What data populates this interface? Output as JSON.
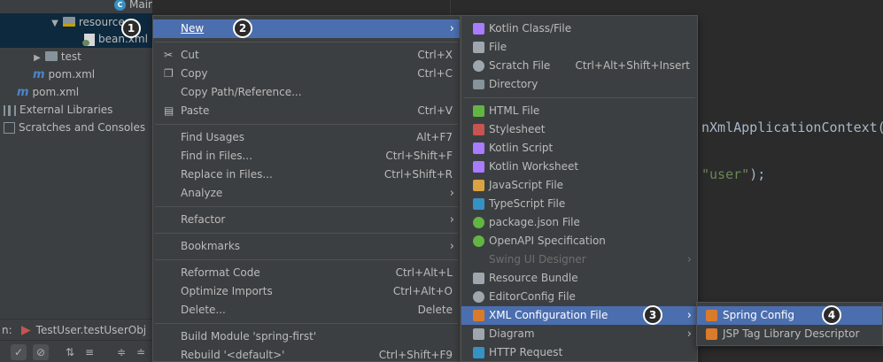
{
  "project_tree": {
    "items": [
      {
        "label": "Main"
      },
      {
        "label": "resources"
      },
      {
        "label": "bean.xml"
      },
      {
        "label": "test"
      },
      {
        "label": "pom.xml"
      },
      {
        "label": "pom.xml"
      },
      {
        "label": "External Libraries"
      },
      {
        "label": "Scratches and Consoles"
      }
    ]
  },
  "run_tab": {
    "prefix": "n:",
    "label": "TestUser.testUserObj"
  },
  "editor": {
    "line1": "nXmlApplicationContext(",
    "line2_str": "\"user\"",
    "line2_rest": ");"
  },
  "context_menu": {
    "items": [
      {
        "label": "New",
        "shortcut": "",
        "submenu": true
      },
      {
        "label": "Cut",
        "shortcut": "Ctrl+X"
      },
      {
        "label": "Copy",
        "shortcut": "Ctrl+C"
      },
      {
        "label": "Copy Path/Reference...",
        "shortcut": ""
      },
      {
        "label": "Paste",
        "shortcut": "Ctrl+V"
      },
      {
        "label": "Find Usages",
        "shortcut": "Alt+F7"
      },
      {
        "label": "Find in Files...",
        "shortcut": "Ctrl+Shift+F"
      },
      {
        "label": "Replace in Files...",
        "shortcut": "Ctrl+Shift+R"
      },
      {
        "label": "Analyze",
        "shortcut": "",
        "submenu": true
      },
      {
        "label": "Refactor",
        "shortcut": "",
        "submenu": true
      },
      {
        "label": "Bookmarks",
        "shortcut": "",
        "submenu": true
      },
      {
        "label": "Reformat Code",
        "shortcut": "Ctrl+Alt+L"
      },
      {
        "label": "Optimize Imports",
        "shortcut": "Ctrl+Alt+O"
      },
      {
        "label": "Delete...",
        "shortcut": "Delete"
      },
      {
        "label": "Build Module 'spring-first'",
        "shortcut": ""
      },
      {
        "label": "Rebuild '<default>'",
        "shortcut": "Ctrl+Shift+F9"
      }
    ]
  },
  "new_submenu": {
    "items": [
      {
        "label": "Kotlin Class/File",
        "shortcut": ""
      },
      {
        "label": "File",
        "shortcut": ""
      },
      {
        "label": "Scratch File",
        "shortcut": "Ctrl+Alt+Shift+Insert"
      },
      {
        "label": "Directory",
        "shortcut": ""
      },
      {
        "label": "HTML File",
        "shortcut": ""
      },
      {
        "label": "Stylesheet",
        "shortcut": ""
      },
      {
        "label": "Kotlin Script",
        "shortcut": ""
      },
      {
        "label": "Kotlin Worksheet",
        "shortcut": ""
      },
      {
        "label": "JavaScript File",
        "shortcut": ""
      },
      {
        "label": "TypeScript File",
        "shortcut": ""
      },
      {
        "label": "package.json File",
        "shortcut": ""
      },
      {
        "label": "OpenAPI Specification",
        "shortcut": ""
      },
      {
        "label": "Swing UI Designer",
        "shortcut": "",
        "disabled": true
      },
      {
        "label": "Resource Bundle",
        "shortcut": ""
      },
      {
        "label": "EditorConfig File",
        "shortcut": ""
      },
      {
        "label": "XML Configuration File",
        "shortcut": "",
        "submenu": true
      },
      {
        "label": "Diagram",
        "shortcut": "",
        "submenu": true
      },
      {
        "label": "HTTP Request",
        "shortcut": ""
      }
    ]
  },
  "xml_submenu": {
    "items": [
      {
        "label": "Spring Config"
      },
      {
        "label": "JSP Tag Library Descriptor"
      }
    ]
  },
  "step_badges": [
    "1",
    "2",
    "3",
    "4"
  ],
  "colors": {
    "highlight": "#4b6eaf",
    "menu_bg": "#3c3f41",
    "editor_bg": "#2b2b2b"
  }
}
